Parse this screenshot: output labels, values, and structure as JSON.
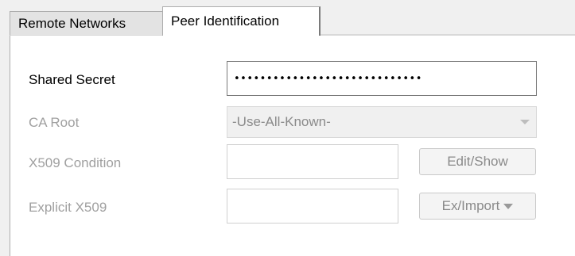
{
  "tabs": {
    "remote_networks": "Remote Networks",
    "peer_identification": "Peer Identification",
    "active": "Peer Identification"
  },
  "form": {
    "shared_secret": {
      "label": "Shared Secret",
      "value": "•••••••••••••••••••••••••••••"
    },
    "ca_root": {
      "label": "CA Root",
      "selected": "-Use-All-Known-"
    },
    "x509_condition": {
      "label": "X509 Condition",
      "value": "",
      "button_label": "Edit/Show"
    },
    "explicit_x509": {
      "label": "Explicit X509",
      "value": "",
      "button_label": "Ex/Import"
    }
  },
  "colors": {
    "enabled_text": "#000000",
    "disabled_text": "#a0a0a0",
    "panel_bg": "#ffffff",
    "window_bg": "#f0f0f0"
  },
  "icons": {
    "select_dropdown": "chevron-down-icon",
    "button_dropdown": "caret-down-icon"
  }
}
